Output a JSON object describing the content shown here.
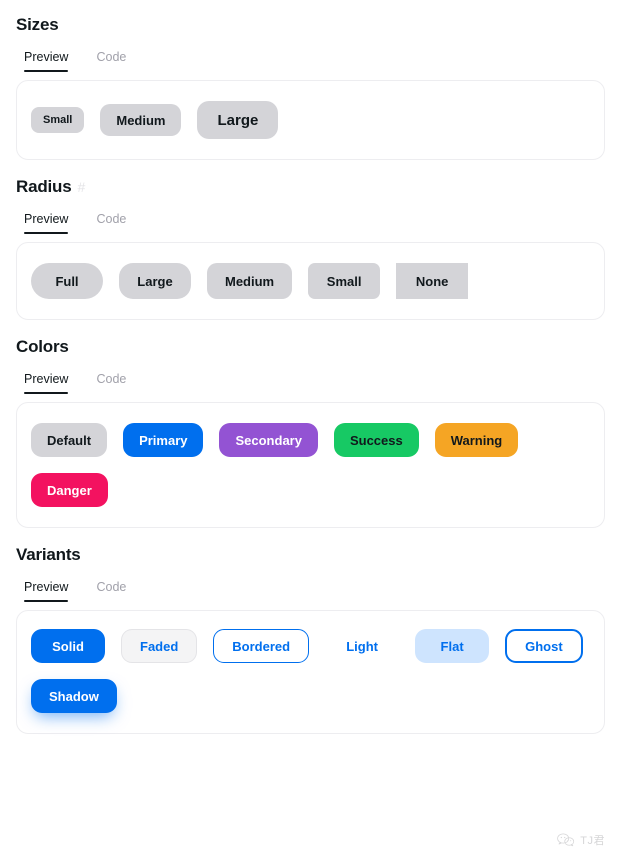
{
  "theme": {
    "accent": "#006FEE",
    "default_bg": "#D4D4D8",
    "secondary": "#9353D3",
    "success": "#17C964",
    "warning": "#F5A524",
    "danger": "#F31260",
    "flat_bg": "#CEE4FE",
    "faded_bg": "#F4F4F5",
    "card_border": "#EDEDF0",
    "text_primary": "#11181C",
    "text_muted": "#A1A1AA"
  },
  "tabs": {
    "preview_label": "Preview",
    "code_label": "Code"
  },
  "sections": [
    {
      "id": "sizes",
      "title": "Sizes",
      "anchor": "",
      "buttons": [
        {
          "label": "Small",
          "size": "sm"
        },
        {
          "label": "Medium",
          "size": "md"
        },
        {
          "label": "Large",
          "size": "lg"
        }
      ]
    },
    {
      "id": "radius",
      "title": "Radius",
      "anchor": "#",
      "buttons": [
        {
          "label": "Full",
          "radius": "full"
        },
        {
          "label": "Large",
          "radius": "large"
        },
        {
          "label": "Medium",
          "radius": "medium"
        },
        {
          "label": "Small",
          "radius": "small"
        },
        {
          "label": "None",
          "radius": "none"
        }
      ]
    },
    {
      "id": "colors",
      "title": "Colors",
      "anchor": "",
      "buttons": [
        {
          "label": "Default",
          "color": "default"
        },
        {
          "label": "Primary",
          "color": "primary"
        },
        {
          "label": "Secondary",
          "color": "secondary"
        },
        {
          "label": "Success",
          "color": "success"
        },
        {
          "label": "Warning",
          "color": "warning"
        },
        {
          "label": "Danger",
          "color": "danger"
        }
      ]
    },
    {
      "id": "variants",
      "title": "Variants",
      "anchor": "",
      "buttons": [
        {
          "label": "Solid",
          "variant": "solid"
        },
        {
          "label": "Faded",
          "variant": "faded"
        },
        {
          "label": "Bordered",
          "variant": "bordered"
        },
        {
          "label": "Light",
          "variant": "light"
        },
        {
          "label": "Flat",
          "variant": "flat"
        },
        {
          "label": "Ghost",
          "variant": "ghost"
        },
        {
          "label": "Shadow",
          "variant": "shadow"
        }
      ]
    }
  ],
  "watermark": {
    "text": "TJ君",
    "icon": "wechat-icon"
  }
}
